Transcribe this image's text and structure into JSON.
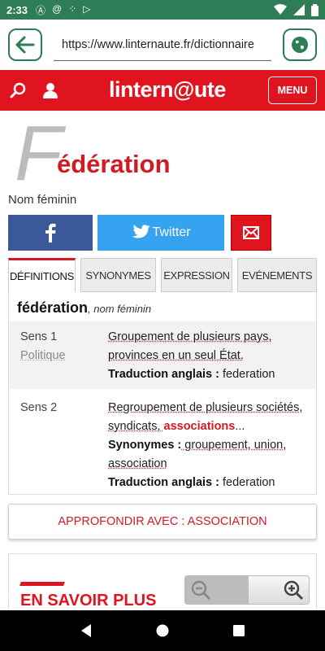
{
  "status": {
    "time": "2:33"
  },
  "browser": {
    "url": "https://www.linternaute.fr/dictionnaire"
  },
  "site": {
    "logo": "lintern@ute",
    "menu_label": "MENU"
  },
  "entry": {
    "big_letter": "F",
    "title": "édération",
    "gender": "Nom féminin"
  },
  "share": {
    "twitter_label": "Twitter"
  },
  "tabs": [
    {
      "label": "DÉFINITIONS",
      "active": true
    },
    {
      "label": "SYNONYMES",
      "active": false
    },
    {
      "label": "EXPRESSION",
      "active": false
    },
    {
      "label": "EVÉNEMENTS",
      "active": false
    }
  ],
  "definition": {
    "word": "fédération",
    "pos": ", nom féminin",
    "senses": [
      {
        "label": "Sens 1",
        "domain": "Politique",
        "text_a": "Groupement de plusieurs pays, provinces en un seul État.",
        "trad_label": "Traduction anglais :",
        "trad_value": " federation"
      },
      {
        "label": "Sens 2",
        "text_a": "Regroupement de plusieurs sociétés, syndicats, ",
        "link": "associations",
        "ellipsis": "...",
        "syn_label": "Synonymes :",
        "syn_value": " groupement, union, association",
        "trad_label": "Traduction anglais :",
        "trad_value": " federation"
      }
    ]
  },
  "approfondir": "APPROFONDIR AVEC : ASSOCIATION",
  "savoir_plus": "EN SAVOIR PLUS",
  "colors": {
    "brand_red": "#e0141e",
    "status_green": "#2e7d57",
    "facebook": "#3b5998",
    "twitter": "#36a3f0"
  }
}
